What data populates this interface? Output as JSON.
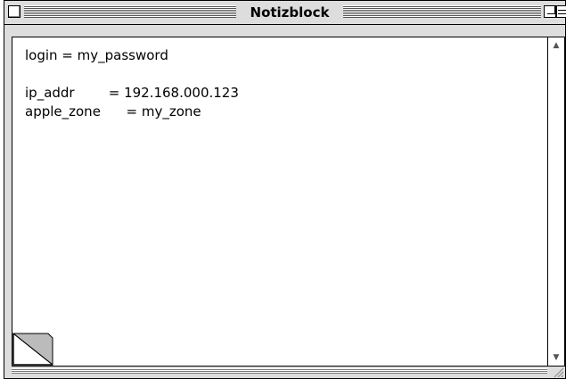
{
  "window": {
    "title": "Notizblock"
  },
  "document": {
    "lines": [
      "login = my_password",
      "",
      "ip_addr        = 192.168.000.123",
      "apple_zone      = my_zone"
    ]
  },
  "icons": {
    "close": "close-box-icon",
    "zoom": "zoom-box-icon",
    "collapse": "collapse-box-icon",
    "scroll_up": "up-arrow-icon",
    "scroll_down": "down-arrow-icon",
    "page_fold": "page-curl-icon",
    "resize": "grow-box-icon"
  }
}
